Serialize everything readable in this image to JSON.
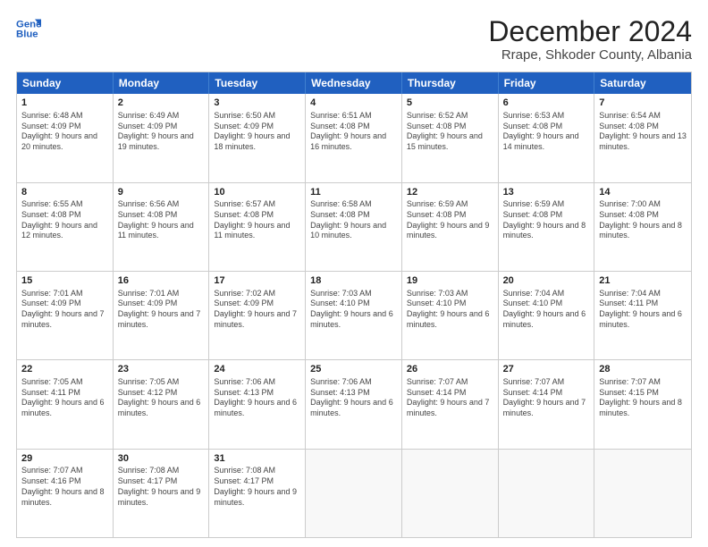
{
  "header": {
    "logo_line1": "General",
    "logo_line2": "Blue",
    "main_title": "December 2024",
    "subtitle": "Rrape, Shkoder County, Albania"
  },
  "days": [
    "Sunday",
    "Monday",
    "Tuesday",
    "Wednesday",
    "Thursday",
    "Friday",
    "Saturday"
  ],
  "weeks": [
    [
      {
        "day": "1",
        "rise": "6:48 AM",
        "set": "4:09 PM",
        "daylight": "9 hours and 20 minutes."
      },
      {
        "day": "2",
        "rise": "6:49 AM",
        "set": "4:09 PM",
        "daylight": "9 hours and 19 minutes."
      },
      {
        "day": "3",
        "rise": "6:50 AM",
        "set": "4:09 PM",
        "daylight": "9 hours and 18 minutes."
      },
      {
        "day": "4",
        "rise": "6:51 AM",
        "set": "4:08 PM",
        "daylight": "9 hours and 16 minutes."
      },
      {
        "day": "5",
        "rise": "6:52 AM",
        "set": "4:08 PM",
        "daylight": "9 hours and 15 minutes."
      },
      {
        "day": "6",
        "rise": "6:53 AM",
        "set": "4:08 PM",
        "daylight": "9 hours and 14 minutes."
      },
      {
        "day": "7",
        "rise": "6:54 AM",
        "set": "4:08 PM",
        "daylight": "9 hours and 13 minutes."
      }
    ],
    [
      {
        "day": "8",
        "rise": "6:55 AM",
        "set": "4:08 PM",
        "daylight": "9 hours and 12 minutes."
      },
      {
        "day": "9",
        "rise": "6:56 AM",
        "set": "4:08 PM",
        "daylight": "9 hours and 11 minutes."
      },
      {
        "day": "10",
        "rise": "6:57 AM",
        "set": "4:08 PM",
        "daylight": "9 hours and 11 minutes."
      },
      {
        "day": "11",
        "rise": "6:58 AM",
        "set": "4:08 PM",
        "daylight": "9 hours and 10 minutes."
      },
      {
        "day": "12",
        "rise": "6:59 AM",
        "set": "4:08 PM",
        "daylight": "9 hours and 9 minutes."
      },
      {
        "day": "13",
        "rise": "6:59 AM",
        "set": "4:08 PM",
        "daylight": "9 hours and 8 minutes."
      },
      {
        "day": "14",
        "rise": "7:00 AM",
        "set": "4:08 PM",
        "daylight": "9 hours and 8 minutes."
      }
    ],
    [
      {
        "day": "15",
        "rise": "7:01 AM",
        "set": "4:09 PM",
        "daylight": "9 hours and 7 minutes."
      },
      {
        "day": "16",
        "rise": "7:01 AM",
        "set": "4:09 PM",
        "daylight": "9 hours and 7 minutes."
      },
      {
        "day": "17",
        "rise": "7:02 AM",
        "set": "4:09 PM",
        "daylight": "9 hours and 7 minutes."
      },
      {
        "day": "18",
        "rise": "7:03 AM",
        "set": "4:10 PM",
        "daylight": "9 hours and 6 minutes."
      },
      {
        "day": "19",
        "rise": "7:03 AM",
        "set": "4:10 PM",
        "daylight": "9 hours and 6 minutes."
      },
      {
        "day": "20",
        "rise": "7:04 AM",
        "set": "4:10 PM",
        "daylight": "9 hours and 6 minutes."
      },
      {
        "day": "21",
        "rise": "7:04 AM",
        "set": "4:11 PM",
        "daylight": "9 hours and 6 minutes."
      }
    ],
    [
      {
        "day": "22",
        "rise": "7:05 AM",
        "set": "4:11 PM",
        "daylight": "9 hours and 6 minutes."
      },
      {
        "day": "23",
        "rise": "7:05 AM",
        "set": "4:12 PM",
        "daylight": "9 hours and 6 minutes."
      },
      {
        "day": "24",
        "rise": "7:06 AM",
        "set": "4:13 PM",
        "daylight": "9 hours and 6 minutes."
      },
      {
        "day": "25",
        "rise": "7:06 AM",
        "set": "4:13 PM",
        "daylight": "9 hours and 6 minutes."
      },
      {
        "day": "26",
        "rise": "7:07 AM",
        "set": "4:14 PM",
        "daylight": "9 hours and 7 minutes."
      },
      {
        "day": "27",
        "rise": "7:07 AM",
        "set": "4:14 PM",
        "daylight": "9 hours and 7 minutes."
      },
      {
        "day": "28",
        "rise": "7:07 AM",
        "set": "4:15 PM",
        "daylight": "9 hours and 8 minutes."
      }
    ],
    [
      {
        "day": "29",
        "rise": "7:07 AM",
        "set": "4:16 PM",
        "daylight": "9 hours and 8 minutes."
      },
      {
        "day": "30",
        "rise": "7:08 AM",
        "set": "4:17 PM",
        "daylight": "9 hours and 9 minutes."
      },
      {
        "day": "31",
        "rise": "7:08 AM",
        "set": "4:17 PM",
        "daylight": "9 hours and 9 minutes."
      },
      null,
      null,
      null,
      null
    ]
  ]
}
